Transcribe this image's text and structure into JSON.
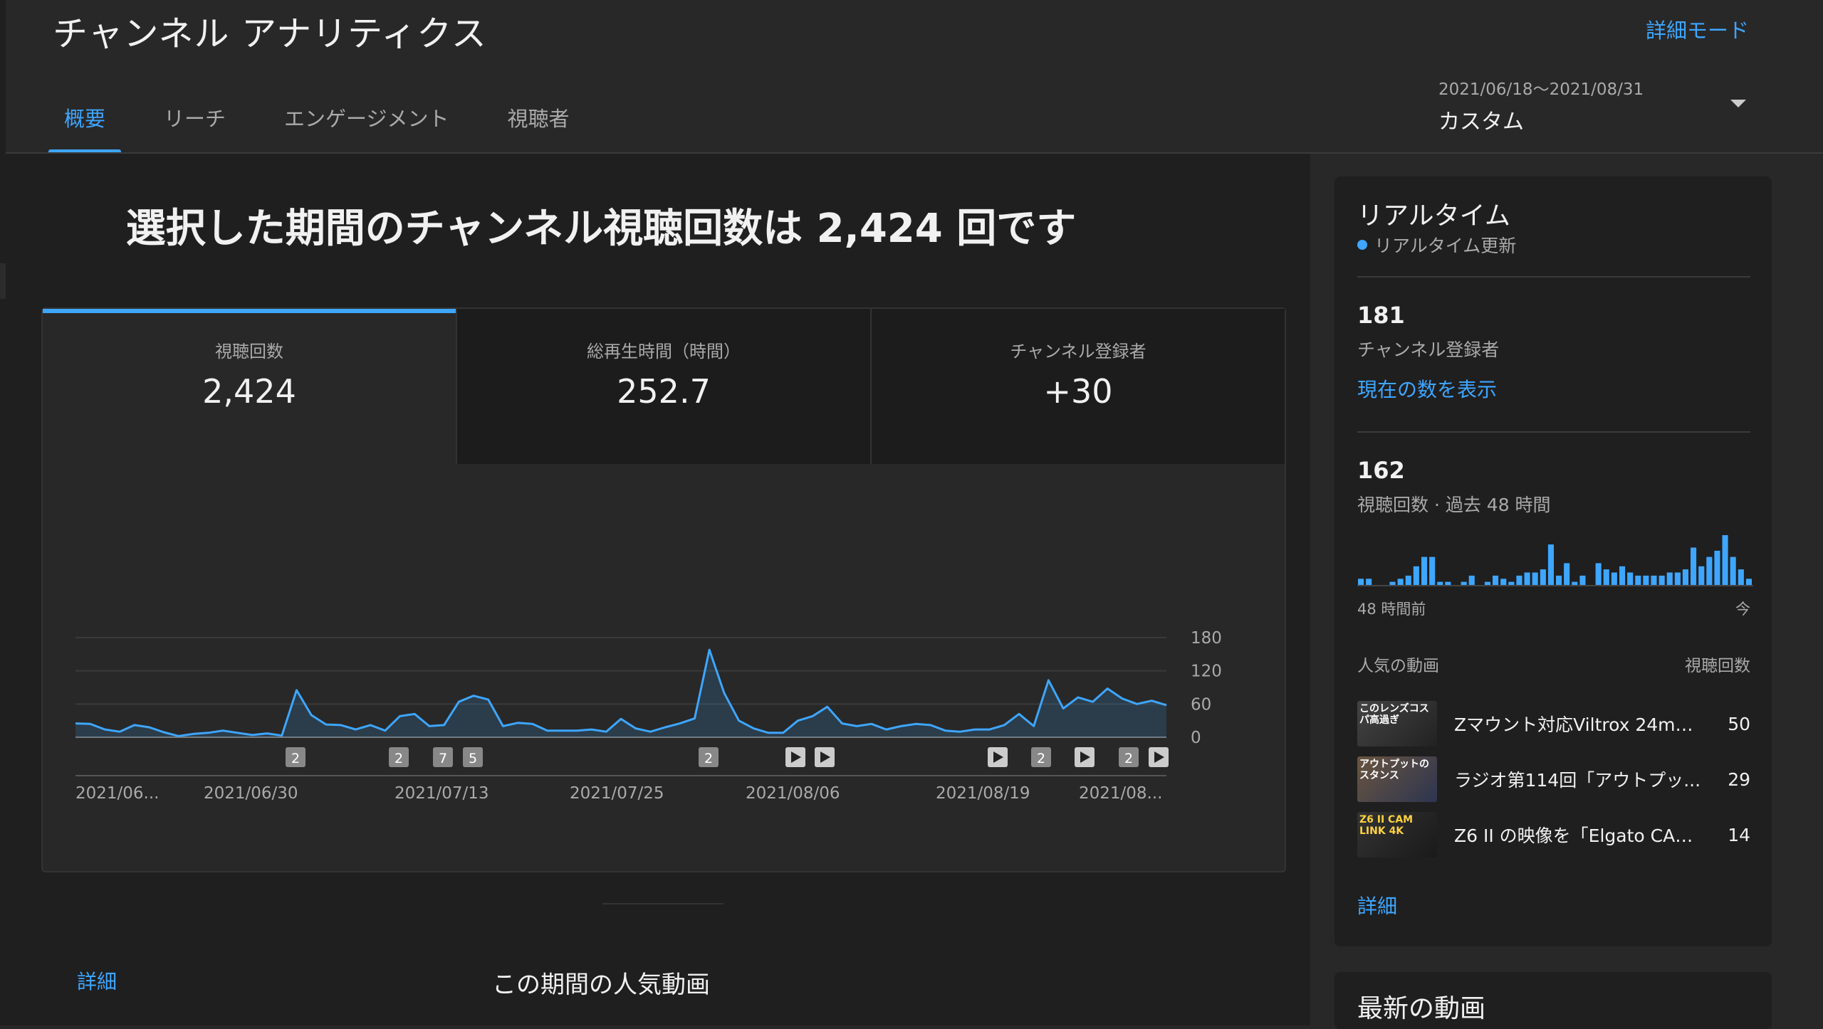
{
  "header": {
    "title": "チャンネル アナリティクス",
    "advanced_mode": "詳細モード",
    "tabs": [
      "概要",
      "リーチ",
      "エンゲージメント",
      "視聴者"
    ],
    "date_range": "2021/06/18〜2021/08/31",
    "date_label": "カスタム"
  },
  "main": {
    "headline": "選択した期間のチャンネル視聴回数は 2,424 回です",
    "metrics": [
      {
        "label": "視聴回数",
        "value": "2,424"
      },
      {
        "label": "総再生時間（時間）",
        "value": "252.7"
      },
      {
        "label": "チャンネル登録者",
        "value": "+30"
      }
    ],
    "detail_link": "詳細",
    "popular_title": "この期間の人気動画"
  },
  "chart_data": {
    "type": "area",
    "x_tick_labels": [
      "2021/06...",
      "2021/06/30",
      "2021/07/13",
      "2021/07/25",
      "2021/08/06",
      "2021/08/19",
      "2021/08..."
    ],
    "y_ticks": [
      0,
      60,
      120,
      180
    ],
    "ylim": [
      0,
      180
    ],
    "values": [
      25,
      24,
      14,
      10,
      22,
      18,
      9,
      2,
      6,
      8,
      12,
      8,
      4,
      7,
      3,
      85,
      40,
      23,
      22,
      14,
      22,
      12,
      38,
      42,
      20,
      22,
      64,
      75,
      68,
      20,
      26,
      24,
      12,
      12,
      12,
      14,
      10,
      33,
      16,
      10,
      18,
      25,
      34,
      158,
      80,
      30,
      16,
      8,
      8,
      30,
      38,
      55,
      25,
      20,
      24,
      14,
      20,
      24,
      22,
      12,
      10,
      14,
      14,
      22,
      42,
      20,
      103,
      52,
      72,
      64,
      88,
      70,
      60,
      66,
      58
    ],
    "grid": true,
    "color": "#3ea6ff",
    "markers": [
      "2",
      "2",
      "7",
      "5",
      "2",
      "play",
      "play",
      "play",
      "2",
      "play",
      "2",
      "play"
    ]
  },
  "realtime": {
    "title": "リアルタイム",
    "live_label": "リアルタイム更新",
    "subscribers_count": "181",
    "subscribers_label": "チャンネル登録者",
    "show_current": "現在の数を表示",
    "views_count": "162",
    "views_label": "視聴回数 · 過去 48 時間",
    "bars": [
      2,
      2,
      0,
      0,
      1,
      2,
      3,
      6,
      9,
      9,
      1,
      1,
      0,
      1,
      3,
      0,
      1,
      3,
      2,
      1,
      3,
      4,
      4,
      5,
      13,
      3,
      7,
      1,
      3,
      0,
      7,
      5,
      4,
      6,
      4,
      3,
      3,
      3,
      3,
      4,
      4,
      5,
      12,
      6,
      9,
      11,
      16,
      9,
      5,
      2
    ],
    "start_label": "48 時間前",
    "end_label": "今",
    "popular_label": "人気の動画",
    "views_header": "視聴回数",
    "videos": [
      {
        "title": "Zマウント対応Viltrox 24mm...",
        "views": "50",
        "thumb_text": "このレンズコスパ高過ぎ",
        "thumb_color": "#3a3a3a"
      },
      {
        "title": "ラジオ第114回「アウトプッ...",
        "views": "29",
        "thumb_text": "アウトプットのスタンス",
        "thumb_color": "#5a4a3a"
      },
      {
        "title": "Z6 II の映像を「Elgato CAM ...",
        "views": "14",
        "thumb_text": "Z6 II CAM LINK 4K",
        "thumb_color": "#2a2a2a"
      }
    ],
    "detail_link": "詳細"
  },
  "latest": {
    "title": "最新の動画"
  }
}
